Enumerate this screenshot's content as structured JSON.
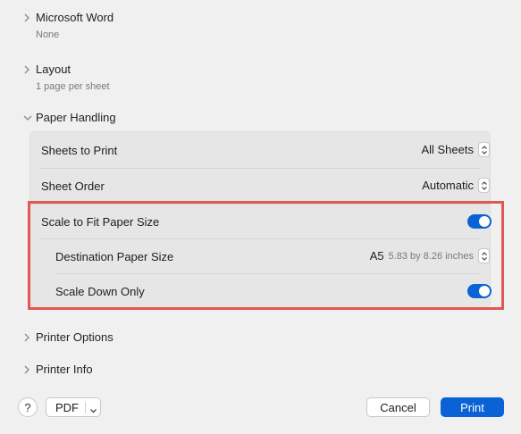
{
  "sections": {
    "word": {
      "title": "Microsoft Word",
      "subtitle": "None"
    },
    "layout": {
      "title": "Layout",
      "subtitle": "1 page per sheet"
    },
    "paper": {
      "title": "Paper Handling"
    },
    "printer_options": {
      "title": "Printer Options"
    },
    "printer_info": {
      "title": "Printer Info"
    }
  },
  "paper_handling": {
    "sheets_to_print": {
      "label": "Sheets to Print",
      "value": "All Sheets"
    },
    "sheet_order": {
      "label": "Sheet Order",
      "value": "Automatic"
    },
    "scale_to_fit": {
      "label": "Scale to Fit Paper Size",
      "enabled": true
    },
    "destination_paper": {
      "label": "Destination Paper Size",
      "value": "A5",
      "detail": "5.83 by 8.26 inches"
    },
    "scale_down_only": {
      "label": "Scale Down Only",
      "enabled": true
    }
  },
  "footer": {
    "help_label": "?",
    "pdf_label": "PDF",
    "cancel_label": "Cancel",
    "print_label": "Print"
  },
  "colors": {
    "accent": "#0a62d4",
    "highlight": "#e0584f"
  }
}
